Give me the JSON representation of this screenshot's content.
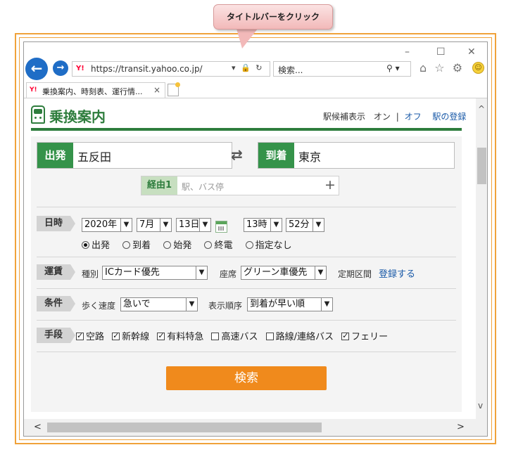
{
  "callout": {
    "text": "タイトルバーをクリック"
  },
  "window_controls": {
    "minimize": "–",
    "maximize": "☐",
    "close": "✕"
  },
  "browser": {
    "back_glyph": "←",
    "forward_glyph": "→",
    "favicon_text": "Y!",
    "url": "https://transit.yahoo.co.jp/",
    "addr_icons": "▾ 🔒 ↻",
    "search_placeholder": "検索...",
    "search_icons": "⚲ ▾",
    "toolbar_icons": [
      "⌂",
      "☆",
      "⚙"
    ],
    "tab_title": "乗換案内、時刻表、運行情...",
    "tab_close": "×"
  },
  "site": {
    "title": "乗換案内",
    "station_suggest_label": "駅候補表示",
    "on_label": "オン",
    "separator": "|",
    "off_label": "オフ",
    "station_register": "駅の登録"
  },
  "form": {
    "from_label": "出発",
    "from_value": "五反田",
    "swap_glyph": "⇄",
    "to_label": "到着",
    "to_value": "東京",
    "via_label": "経由1",
    "via_placeholder": "駅、バス停",
    "via_add": "+",
    "datetime_label": "日時",
    "year": "2020年",
    "month": "7月",
    "day": "13日",
    "hour": "13時",
    "minute": "52分",
    "time_options": [
      {
        "label": "出発",
        "selected": true
      },
      {
        "label": "到着",
        "selected": false
      },
      {
        "label": "始発",
        "selected": false
      },
      {
        "label": "終電",
        "selected": false
      },
      {
        "label": "指定なし",
        "selected": false
      }
    ],
    "fare_label": "運賃",
    "fare_type_label": "種別",
    "fare_type_value": "ICカード優先",
    "seat_label": "座席",
    "seat_value": "グリーン車優先",
    "commuter_label": "定期区間",
    "commuter_link": "登録する",
    "condition_label": "条件",
    "walk_speed_label": "歩く速度",
    "walk_speed_value": "急いで",
    "sort_label": "表示順序",
    "sort_value": "到着が早い順",
    "means_label": "手段",
    "means": [
      {
        "label": "空路",
        "checked": true
      },
      {
        "label": "新幹線",
        "checked": true
      },
      {
        "label": "有料特急",
        "checked": true
      },
      {
        "label": "高速バス",
        "checked": false
      },
      {
        "label": "路線/連絡バス",
        "checked": false
      },
      {
        "label": "フェリー",
        "checked": true
      }
    ],
    "search_button": "検索"
  },
  "scrollbars": {
    "up": "^",
    "down": "v",
    "left": "<",
    "right": ">"
  }
}
